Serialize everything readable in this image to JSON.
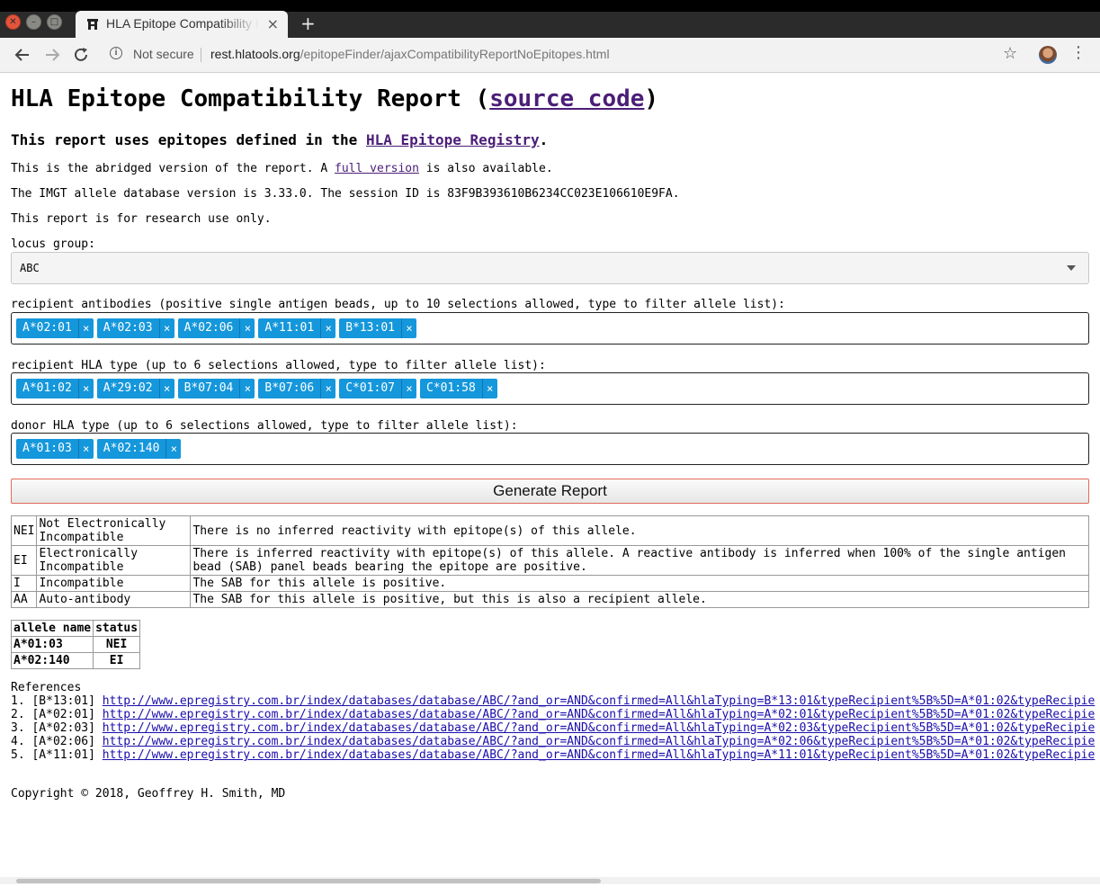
{
  "browser": {
    "tab_title": "HLA Epitope Compatibility Report",
    "tab_close": "×",
    "new_tab": "+",
    "security_label": "Not secure",
    "url_host": "rest.hlatools.org",
    "url_path": "/epitopeFinder/ajaxCompatibilityReportNoEpitopes.html",
    "icons": [
      "back-icon",
      "forward-icon",
      "reload-icon",
      "info-icon",
      "star-icon",
      "avatar",
      "menu-icon"
    ]
  },
  "page": {
    "title_prefix": "HLA Epitope Compatibility Report (",
    "title_link": "source code",
    "title_suffix": ")",
    "subtitle_prefix": "This report uses epitopes defined in the ",
    "subtitle_link": "HLA Epitope Registry",
    "subtitle_suffix": ".",
    "abridged_prefix": "This is the abridged version of the report. A ",
    "abridged_link": "full version",
    "abridged_suffix": " is also available.",
    "db_version": "The IMGT allele database version is 3.33.0. The session ID is 83F9B393610B6234CC023E106610E9FA.",
    "research_note": "This report is for research use only.",
    "locus_label": "locus group:",
    "locus_value": "ABC",
    "antibodies_label": "recipient antibodies (positive single antigen beads, up to 10 selections allowed, type to filter allele list):",
    "antibodies": [
      "A*02:01",
      "A*02:03",
      "A*02:06",
      "A*11:01",
      "B*13:01"
    ],
    "recipient_label": "recipient HLA type (up to 6 selections allowed, type to filter allele list):",
    "recipient_types": [
      "A*01:02",
      "A*29:02",
      "B*07:04",
      "B*07:06",
      "C*01:07",
      "C*01:58"
    ],
    "donor_label": "donor HLA type (up to 6 selections allowed, type to filter allele list):",
    "donor_types": [
      "A*01:03",
      "A*02:140"
    ],
    "remove_symbol": "×",
    "generate_button": "Generate Report",
    "legend": [
      {
        "code": "NEI",
        "name": "Not Electronically Incompatible",
        "desc": "There is no inferred reactivity with epitope(s) of this allele."
      },
      {
        "code": "EI",
        "name": "Electronically Incompatible",
        "desc": "There is inferred reactivity with epitope(s) of this allele. A reactive antibody is inferred when 100% of the single antigen bead (SAB) panel beads bearing the epitope are positive."
      },
      {
        "code": "I",
        "name": "Incompatible",
        "desc": "The SAB for this allele is positive."
      },
      {
        "code": "AA",
        "name": "Auto-antibody",
        "desc": "The SAB for this allele is positive, but this is also a recipient allele."
      }
    ],
    "status_headers": [
      "allele name",
      "status"
    ],
    "status_rows": [
      {
        "allele": "A*01:03",
        "status": "NEI"
      },
      {
        "allele": "A*02:140",
        "status": "EI"
      }
    ],
    "references_label": "References",
    "references": [
      {
        "label": "1. [B*13:01] ",
        "url": "http://www.epregistry.com.br/index/databases/database/ABC/?and_or=AND&confirmed=All&hlaTyping=B*13:01&typeRecipient%5B%5D=A*01:02&typeRecipie"
      },
      {
        "label": "2. [A*02:01] ",
        "url": "http://www.epregistry.com.br/index/databases/database/ABC/?and_or=AND&confirmed=All&hlaTyping=A*02:01&typeRecipient%5B%5D=A*01:02&typeRecipie"
      },
      {
        "label": "3. [A*02:03] ",
        "url": "http://www.epregistry.com.br/index/databases/database/ABC/?and_or=AND&confirmed=All&hlaTyping=A*02:03&typeRecipient%5B%5D=A*01:02&typeRecipie"
      },
      {
        "label": "4. [A*02:06] ",
        "url": "http://www.epregistry.com.br/index/databases/database/ABC/?and_or=AND&confirmed=All&hlaTyping=A*02:06&typeRecipient%5B%5D=A*01:02&typeRecipie"
      },
      {
        "label": "5. [A*11:01] ",
        "url": "http://www.epregistry.com.br/index/databases/database/ABC/?and_or=AND&confirmed=All&hlaTyping=A*11:01&typeRecipient%5B%5D=A*01:02&typeRecipie"
      }
    ],
    "copyright": "Copyright © 2018, Geoffrey H. Smith, MD"
  },
  "colors": {
    "tag_bg": "#1597dc",
    "link_visited": "#4b1e78",
    "link": "#1a0dab",
    "button_border": "#e06a5a"
  }
}
